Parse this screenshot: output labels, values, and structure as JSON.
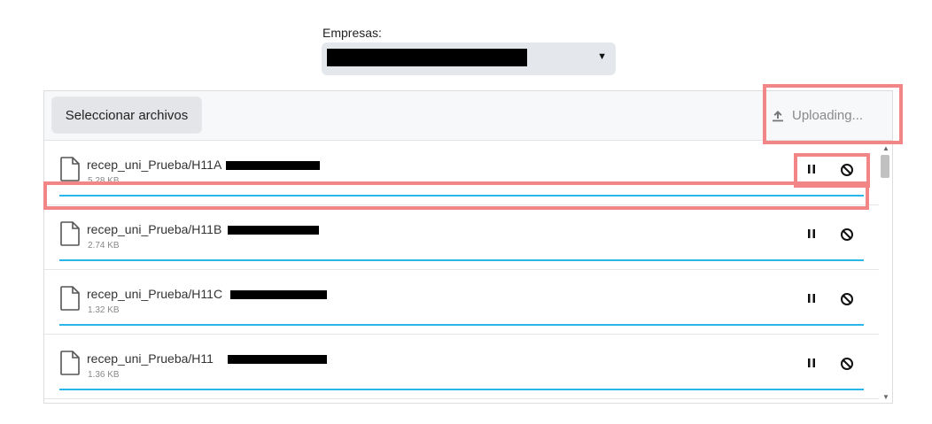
{
  "empresas": {
    "label": "Empresas:",
    "selected": ""
  },
  "toolbar": {
    "select_files_label": "Seleccionar archivos",
    "status_label": "Uploading..."
  },
  "files": [
    {
      "name": "recep_uni_Prueba/H11A",
      "size": "5.28 KB"
    },
    {
      "name": "recep_uni_Prueba/H11B",
      "size": "2.74 KB"
    },
    {
      "name": "recep_uni_Prueba/H11C",
      "size": "1.32 KB"
    },
    {
      "name": "recep_uni_Prueba/H11",
      "size": "1.36 KB"
    }
  ],
  "icons": {
    "file": "file-icon",
    "pause": "pause-icon",
    "cancel": "cancel-icon",
    "upload": "upload-icon",
    "dropdown": "chevron-down-icon"
  },
  "colors": {
    "progress": "#29b6e8",
    "highlight": "#f28585",
    "select_bg": "#e4e7eb"
  }
}
